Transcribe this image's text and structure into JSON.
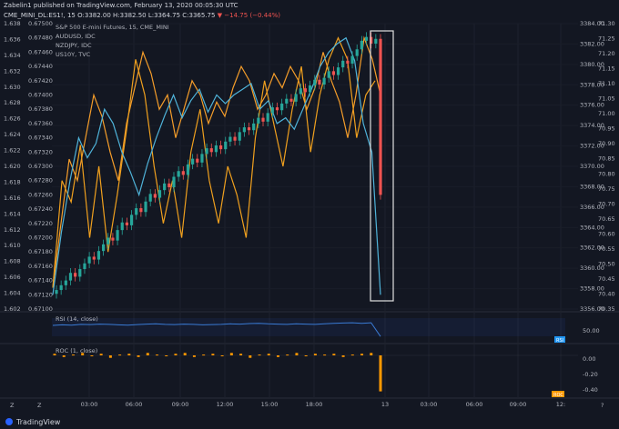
{
  "header": {
    "published": "Zabelin1 published on TradingView.com, February 13, 2020 00:05:30 UTC",
    "symbol": "CME_MINI_DL:ES1!, 15",
    "ohlc": "O:3382.00 H:3382.50 L:3364.75 C:3365.75",
    "change": "▼ −14.75 (−0.44%)"
  },
  "legend": {
    "main": "S&P 500 E-mini Futures, 15, CME_MINI",
    "s1": "AUDUSD, IDC",
    "s2": "NZDJPY, IDC",
    "s3": "US10Y, TVC"
  },
  "indicators": {
    "rsi_label": "RSI (14, close)",
    "rsi_value": "50.00",
    "rsi_badge": "RSI",
    "roc_label": "ROC (1, close)",
    "roc_ticks": [
      "0.00",
      "-0.20",
      "-0.40"
    ],
    "roc_badge": "ROC"
  },
  "footer": {
    "brand": "TradingView",
    "left_ctrl_a": "Z",
    "left_ctrl_b": "Z",
    "right_ctrl": "?"
  },
  "colors": {
    "bg": "#131722",
    "up": "#26a69a",
    "down": "#ef5350",
    "audusd": "#f59d2a",
    "nzdjpy": "#4fb3d9",
    "us10y": "#f0a01e",
    "rsi": "#3a7bd5",
    "roc": "#ff9800",
    "badge_rsi": "#2196f3",
    "badge_roc": "#ff9800"
  },
  "chart_data": {
    "type": "candlestick",
    "x_ticks": [
      "03:00",
      "06:00",
      "09:00",
      "12:00",
      "15:00",
      "18:00",
      "13",
      "03:00",
      "06:00",
      "09:00",
      "12:"
    ],
    "y_left1": {
      "ylim": [
        1.6,
        1.64
      ],
      "ticks": [
        "1.638",
        "1.636",
        "1.634",
        "1.632",
        "1.630",
        "1.628",
        "1.626",
        "1.624",
        "1.622",
        "1.620",
        "1.618",
        "1.616",
        "1.614",
        "1.612",
        "1.610",
        "1.608",
        "1.606",
        "1.604",
        "1.602"
      ]
    },
    "y_left2": {
      "ylim": [
        0.671,
        0.675
      ],
      "ticks": [
        "0.67500",
        "0.67480",
        "0.67460",
        "0.67440",
        "0.67420",
        "0.67400",
        "0.67380",
        "0.67360",
        "0.67340",
        "0.67320",
        "0.67300",
        "0.67280",
        "0.67260",
        "0.67240",
        "0.67220",
        "0.67200",
        "0.67180",
        "0.67160",
        "0.67140",
        "0.67120",
        "0.67100"
      ]
    },
    "y_right1": {
      "ylim": [
        3354,
        3384
      ],
      "ticks": [
        "3384.00",
        "3382.00",
        "3380.00",
        "3378.00",
        "3376.00",
        "3374.00",
        "3372.00",
        "3370.00",
        "3368.00",
        "3366.00",
        "3364.00",
        "3362.00",
        "3360.00",
        "3358.00",
        "3356.00"
      ]
    },
    "y_right2": {
      "ylim": [
        70.35,
        71.35
      ],
      "ticks": [
        "71.30",
        "71.25",
        "71.20",
        "71.15",
        "71.10",
        "71.05",
        "71.00",
        "70.95",
        "70.90",
        "70.85",
        "70.80",
        "70.75",
        "70.70",
        "70.65",
        "70.60",
        "70.55",
        "70.50",
        "70.45",
        "70.40",
        "70.35"
      ]
    },
    "es_close": [
      3356,
      3356.5,
      3357,
      3357.8,
      3357.4,
      3358.2,
      3358.8,
      3359.5,
      3359.2,
      3360.1,
      3360.8,
      3361.5,
      3361.2,
      3362.3,
      3363.1,
      3362.8,
      3363.9,
      3364.6,
      3364.2,
      3365.3,
      3366.1,
      3365.7,
      3366.5,
      3367.2,
      3366.8,
      3367.9,
      3368.5,
      3368.1,
      3369.2,
      3369.8,
      3369.4,
      3370.3,
      3370.9,
      3370.5,
      3371.2,
      3370.8,
      3371.6,
      3372.1,
      3371.7,
      3372.6,
      3373.1,
      3372.8,
      3373.5,
      3374.1,
      3373.7,
      3374.6,
      3375.2,
      3374.9,
      3375.6,
      3376.1,
      3375.8,
      3376.6,
      3377.2,
      3376.8,
      3377.5,
      3378.1,
      3377.6,
      3378.3,
      3379.0,
      3378.6,
      3379.4,
      3380.1,
      3379.8,
      3380.6,
      3381.3,
      3382.2,
      3382.6,
      3381.9,
      3382.4,
      3366.0
    ],
    "audusd": [
      1.603,
      1.612,
      1.621,
      1.618,
      1.624,
      1.63,
      1.627,
      1.622,
      1.618,
      1.626,
      1.631,
      1.636,
      1.633,
      1.628,
      1.63,
      1.624,
      1.628,
      1.632,
      1.63,
      1.626,
      1.629,
      1.627,
      1.631,
      1.634,
      1.632,
      1.628,
      1.63,
      1.633,
      1.631,
      1.634,
      1.632,
      1.628,
      1.631,
      1.636,
      1.632,
      1.629,
      1.624,
      1.63,
      1.638,
      1.635,
      1.63
    ],
    "nzdjpy": [
      70.4,
      70.62,
      70.8,
      70.95,
      70.88,
      70.93,
      71.05,
      71.0,
      70.9,
      70.83,
      70.75,
      70.86,
      70.95,
      71.03,
      71.1,
      71.02,
      71.08,
      71.12,
      71.04,
      71.1,
      71.07,
      71.1,
      71.12,
      71.14,
      71.05,
      71.08,
      71.0,
      71.02,
      70.98,
      71.05,
      71.12,
      71.2,
      71.25,
      71.28,
      71.3,
      71.22,
      71.0,
      70.9,
      70.4
    ],
    "us10y": [
      0.6713,
      0.6728,
      0.6725,
      0.6733,
      0.672,
      0.673,
      0.6718,
      0.6726,
      0.6735,
      0.6745,
      0.674,
      0.673,
      0.6722,
      0.6728,
      0.672,
      0.6732,
      0.6738,
      0.6728,
      0.6722,
      0.673,
      0.6726,
      0.672,
      0.6734,
      0.6742,
      0.6736,
      0.673,
      0.6738,
      0.6744,
      0.6732,
      0.674,
      0.6745,
      0.6748,
      0.6745,
      0.6734,
      0.674,
      0.6742
    ],
    "rsi": [
      62,
      64,
      63,
      66,
      65,
      67,
      66,
      64,
      63,
      65,
      67,
      68,
      66,
      65,
      67,
      66,
      64,
      65,
      66,
      68,
      67,
      69,
      70,
      68,
      67,
      66,
      68,
      67,
      66,
      68,
      70,
      71,
      72,
      70,
      72,
      20
    ],
    "roc": [
      0.02,
      -0.02,
      0.01,
      0.03,
      -0.01,
      0.02,
      -0.03,
      0.01,
      0.02,
      -0.02,
      0.03,
      0.01,
      -0.01,
      0.02,
      0.03,
      -0.02,
      0.01,
      0.02,
      -0.01,
      0.03,
      0.02,
      -0.03,
      0.01,
      0.02,
      -0.02,
      0.01,
      0.03,
      -0.01,
      0.02,
      0.01,
      0.02,
      -0.02,
      0.01,
      0.02,
      0.03,
      -0.44
    ],
    "rsi_ylim": [
      0,
      100
    ],
    "roc_ylim": [
      -0.5,
      0.1
    ],
    "annotation": "highlight-box-last-bars"
  }
}
